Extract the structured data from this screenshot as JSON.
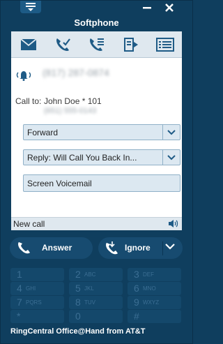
{
  "window": {
    "title": "Softphone"
  },
  "toolbar": {
    "icons": [
      "envelope-icon",
      "call-log-icon",
      "voicemail-list-icon",
      "fax-icon",
      "contacts-list-icon"
    ]
  },
  "call": {
    "number": "(817) 287-0874",
    "call_to_label": "Call to:",
    "call_to_name": "John Doe * 101",
    "call_to_number": "(651) 555-0143"
  },
  "actions": {
    "forward_label": "Forward",
    "reply_label": "Reply: Will Call You Back In...",
    "voicemail_label": "Screen Voicemail"
  },
  "status": {
    "text": "New call"
  },
  "buttons": {
    "answer": "Answer",
    "ignore": "Ignore"
  },
  "keypad": [
    {
      "digit": "1",
      "letters": ""
    },
    {
      "digit": "2",
      "letters": "ABC"
    },
    {
      "digit": "3",
      "letters": "DEF"
    },
    {
      "digit": "4",
      "letters": "GHI"
    },
    {
      "digit": "5",
      "letters": "JKL"
    },
    {
      "digit": "6",
      "letters": "MNO"
    },
    {
      "digit": "7",
      "letters": "PQRS"
    },
    {
      "digit": "8",
      "letters": "TUV"
    },
    {
      "digit": "9",
      "letters": "WXYZ"
    },
    {
      "digit": "*",
      "letters": ""
    },
    {
      "digit": "0",
      "letters": ""
    },
    {
      "digit": "#",
      "letters": ""
    }
  ],
  "footer": {
    "text": "RingCentral Office@Hand from AT&T"
  }
}
